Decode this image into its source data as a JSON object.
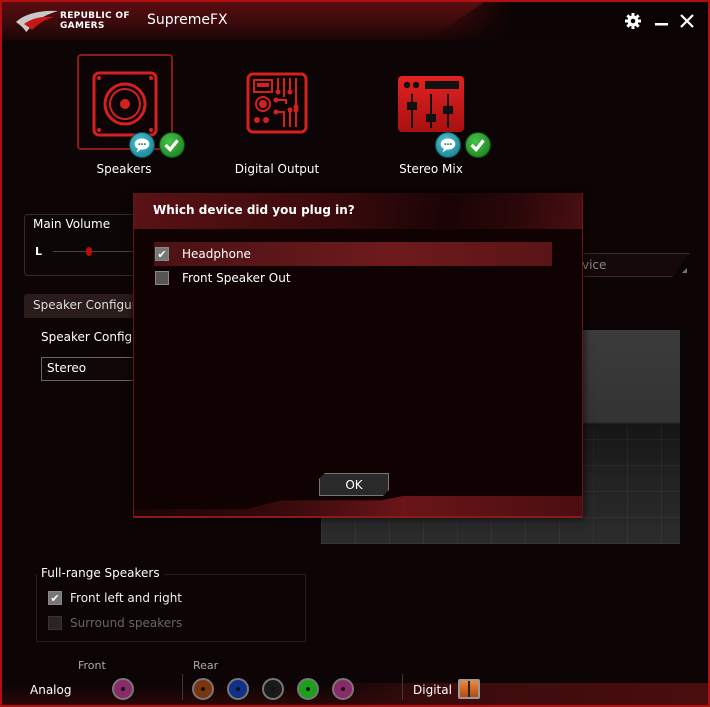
{
  "window": {
    "brand": [
      "REPUBLIC OF",
      "GAMERS"
    ],
    "title": "SupremeFX",
    "controls": {
      "settings": "gear-icon",
      "minimize": "minimize-icon",
      "close": "close-icon"
    }
  },
  "devices": [
    {
      "label": "Speakers",
      "icon": "speaker-icon",
      "selected": true,
      "badges": [
        "chat-icon",
        "check-icon"
      ]
    },
    {
      "label": "Digital Output",
      "icon": "circuit-board-icon",
      "selected": false,
      "badges": []
    },
    {
      "label": "Stereo Mix",
      "icon": "mixer-icon",
      "selected": false,
      "badges": [
        "chat-icon",
        "check-icon"
      ]
    }
  ],
  "main_volume": {
    "title": "Main Volume",
    "channel_label": "L",
    "balance_fraction": 0.45
  },
  "speaker_config": {
    "tab_label": "Speaker Configurat",
    "field_label": "Speaker Configur",
    "selected_value": "Stereo"
  },
  "default_device_field": {
    "visible_text": "vice"
  },
  "full_range": {
    "title": "Full-range Speakers",
    "options": [
      {
        "label": "Front left and right",
        "checked": true,
        "enabled": true
      },
      {
        "label": "Surround speakers",
        "checked": false,
        "enabled": false
      }
    ]
  },
  "jacks": {
    "analog_label": "Analog",
    "front_label": "Front",
    "rear_label": "Rear",
    "digital_label": "Digital",
    "front": [
      {
        "color": "#8a2a6a",
        "name": "front-pink-jack"
      }
    ],
    "rear": [
      {
        "color": "#7a3410",
        "name": "rear-orange-jack"
      },
      {
        "color": "#10308a",
        "name": "rear-blue-jack"
      },
      {
        "color": "#1a1a1a",
        "name": "rear-black-jack"
      },
      {
        "color": "#1aa01a",
        "name": "rear-green-jack"
      },
      {
        "color": "#8a2a6a",
        "name": "rear-pink-jack"
      }
    ]
  },
  "dialog": {
    "title": "Which device did you plug in?",
    "options": [
      {
        "label": "Headphone",
        "checked": true,
        "highlighted": true
      },
      {
        "label": "Front Speaker Out",
        "checked": false,
        "highlighted": false
      }
    ],
    "ok_label": "OK"
  },
  "colors": {
    "accent": "#b01010",
    "background": "#0d0405",
    "check_badge": "#2a9a2c",
    "chat_badge": "#1f95a5"
  }
}
